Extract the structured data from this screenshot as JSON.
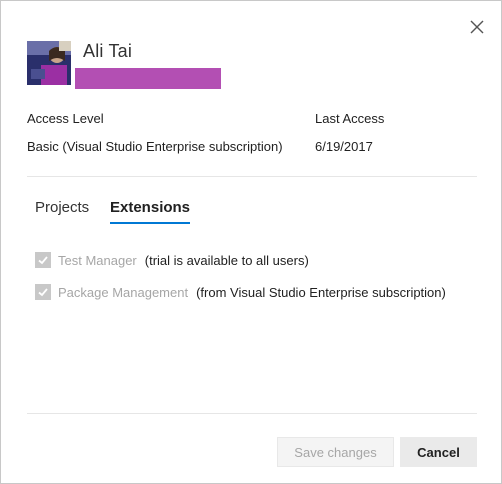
{
  "user": {
    "name": "Ali Tai",
    "redaction_color": "#b34fb3"
  },
  "details": {
    "access_level_label": "Access Level",
    "access_level_value": "Basic (Visual Studio Enterprise subscription)",
    "last_access_label": "Last Access",
    "last_access_value": "6/19/2017"
  },
  "tabs": [
    {
      "label": "Projects",
      "selected": false
    },
    {
      "label": "Extensions",
      "selected": true
    }
  ],
  "extensions": [
    {
      "name": "Test Manager",
      "note": "(trial is available to all users)",
      "checked": true,
      "disabled": true
    },
    {
      "name": "Package Management",
      "note": "(from Visual Studio Enterprise subscription)",
      "checked": true,
      "disabled": true
    }
  ],
  "footer": {
    "save_label": "Save changes",
    "cancel_label": "Cancel"
  },
  "icons": {
    "close": "close-icon",
    "check": "checkmark-icon"
  },
  "colors": {
    "accent": "#0078d4",
    "disabled_text": "#a6a6a6"
  }
}
